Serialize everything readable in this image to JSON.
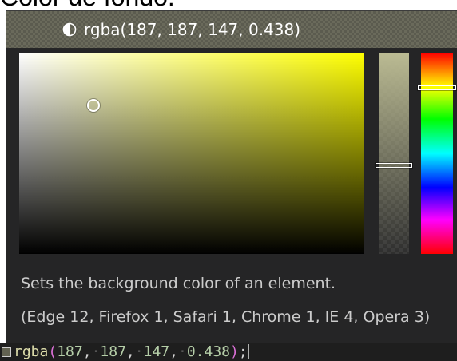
{
  "background_text": "Color de fondo:",
  "header": {
    "color_value": "rgba(187, 187, 147, 0.438)"
  },
  "picker": {
    "hue_color": "#ffff00",
    "selected_color": "rgba(187, 187, 147, 0.438)",
    "alpha": 0.438
  },
  "hover": {
    "description": "Sets the background color of an element.",
    "compatibility": "(Edge 12, Firefox 1, Safari 1, Chrome 1, IE 4, Opera 3)"
  },
  "editor": {
    "function_name": "rgba",
    "open_paren": "(",
    "close_paren": ")",
    "arg1": "187",
    "arg2": "187",
    "arg3": "147",
    "arg4": "0.438",
    "separator": ",",
    "space_dot": "·",
    "terminator": ";"
  }
}
